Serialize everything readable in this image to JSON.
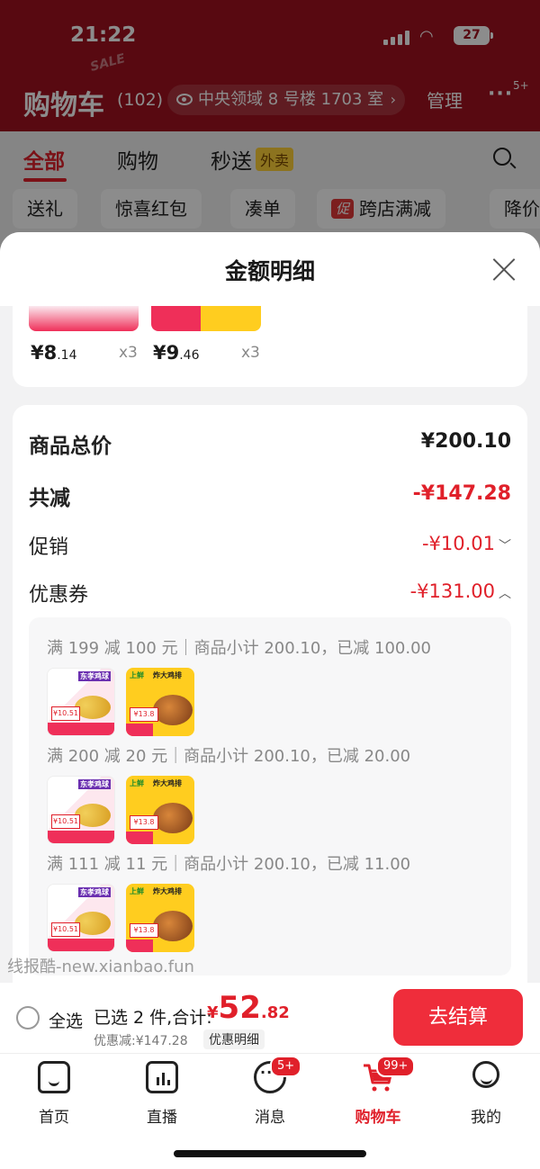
{
  "status_bar": {
    "time": "21:22",
    "battery": "27"
  },
  "header": {
    "title": "购物车",
    "count": "(102)",
    "sale_text": "SALE",
    "address": "中央领域 8 号楼 1703 室",
    "manage": "管理",
    "more_badge": "5+"
  },
  "tabs": [
    {
      "label": "全部",
      "active": true
    },
    {
      "label": "购物"
    },
    {
      "label": "秒送",
      "tag": "外卖"
    }
  ],
  "filters": [
    {
      "label": "送礼"
    },
    {
      "label": "惊喜红包"
    },
    {
      "label": "凑单"
    },
    {
      "label": "跨店满减",
      "tag": "促"
    },
    {
      "label": "降价"
    }
  ],
  "sheet": {
    "title": "金额明细",
    "items": [
      {
        "price_int": "¥8",
        "price_dec": ".14",
        "qty": "x3"
      },
      {
        "price_int": "¥9",
        "price_dec": ".46",
        "qty": "x3"
      }
    ],
    "rows": {
      "subtotal": {
        "label": "商品总价",
        "value": "¥200.10"
      },
      "total_discount": {
        "label": "共减",
        "value": "-¥147.28"
      },
      "promotion": {
        "label": "促销",
        "value": "-¥10.01"
      },
      "coupon": {
        "label": "优惠券",
        "value": "-¥131.00"
      }
    },
    "coupons": [
      {
        "text": "满 199 减 100 元｜商品小计 200.10，已减 100.00"
      },
      {
        "text": "满 200 减 20 元｜商品小计 200.10，已减 20.00"
      },
      {
        "text": "满 111 减 11 元｜商品小计 200.10，已减 11.00"
      }
    ],
    "thumb_labels": {
      "a_title": "东孝鸡球",
      "a_price": "¥10.51",
      "b_title": "炸大鸡排",
      "b_brand": "上鲜",
      "b_price": "¥13.8"
    }
  },
  "watermark": "线报酷-new.xianbao.fun",
  "checkout": {
    "select_all": "全选",
    "selected": "已选 2 件,合计:",
    "currency": "¥",
    "total_int": "52",
    "total_dec": ".82",
    "discount": "优惠减:¥147.28",
    "detail": "优惠明细",
    "pay": "去结算"
  },
  "nav": [
    {
      "label": "首页"
    },
    {
      "label": "直播"
    },
    {
      "label": "消息",
      "badge": "5+"
    },
    {
      "label": "购物车",
      "badge": "99+",
      "active": true
    },
    {
      "label": "我的"
    }
  ],
  "colors": {
    "accent": "#e0202a",
    "header_bg": "#a1121f",
    "pay_button": "#ef2d3b"
  }
}
